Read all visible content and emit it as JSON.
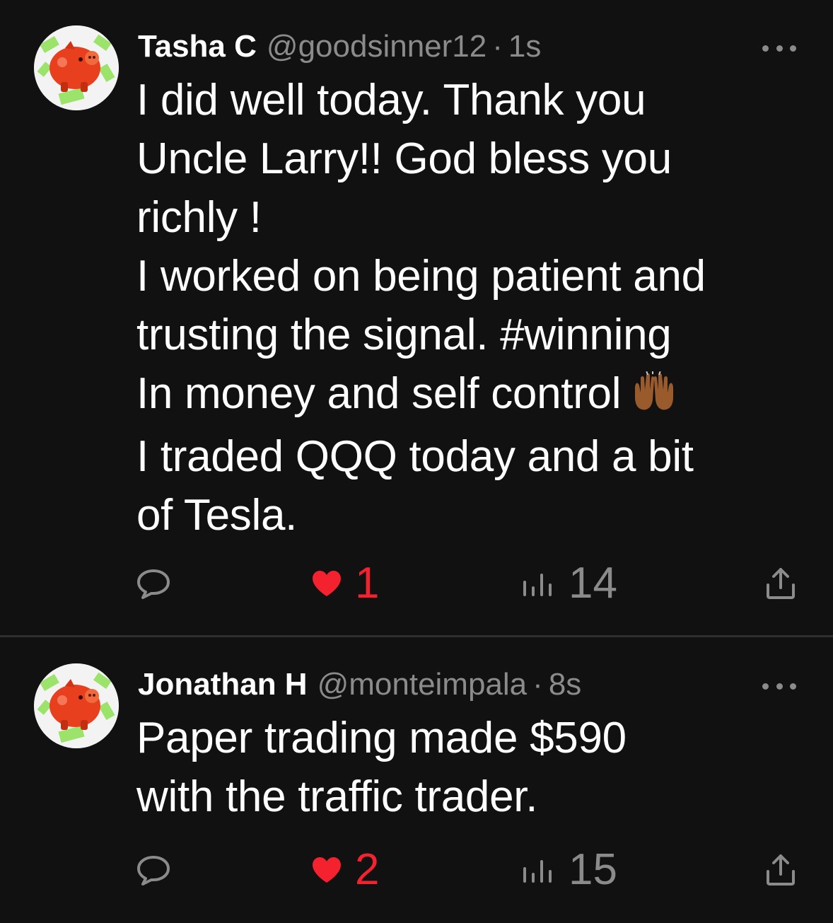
{
  "feed": {
    "posts": [
      {
        "author_name": "Tasha C",
        "handle": "@goodsinner12",
        "separator": "·",
        "time": "1s",
        "avatar_icon": "piggy-bank-avatar",
        "body_lines": [
          "I did well today. Thank you",
          "Uncle Larry!! God bless you",
          "richly !",
          "I worked on being patient and",
          "trusting the signal. #winning",
          "In money and self control",
          "I traded QQQ today and a bit",
          "of Tesla."
        ],
        "emoji_icon": "raising-hands-emoji",
        "likes": "1",
        "views": "14"
      },
      {
        "author_name": "Jonathan H",
        "handle": "@monteimpala",
        "separator": "·",
        "time": "8s",
        "avatar_icon": "piggy-bank-avatar",
        "body_lines": [
          "Paper trading made $590",
          "with the traffic trader."
        ],
        "likes": "2",
        "views": "15"
      }
    ]
  },
  "colors": {
    "background": "#111111",
    "text": "#ffffff",
    "muted": "#8b8b8b",
    "like": "#f4212e",
    "divider": "#2f2f2f"
  },
  "icons": {
    "reply": "comment-bubble-icon",
    "like": "heart-icon",
    "views": "bar-chart-icon",
    "share": "share-upload-icon",
    "more": "more-dots-icon"
  }
}
